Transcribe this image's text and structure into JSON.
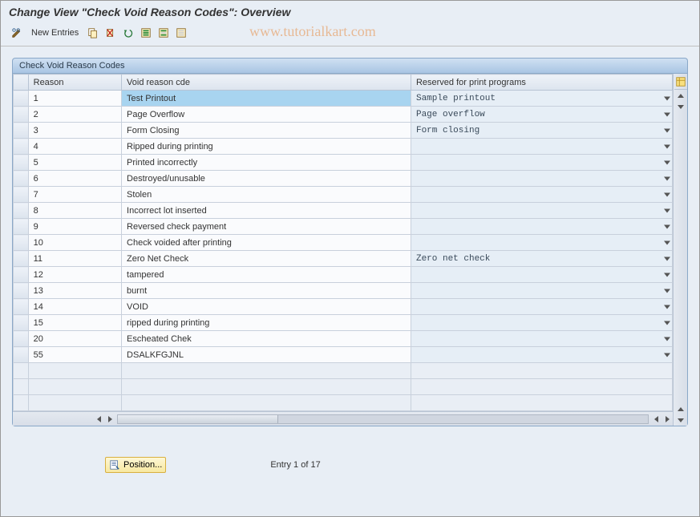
{
  "title": "Change View \"Check Void Reason Codes\": Overview",
  "toolbar": {
    "new_entries_label": "New Entries"
  },
  "watermark": "www.tutorialkart.com",
  "panel": {
    "header": "Check Void Reason Codes",
    "columns": {
      "reason": "Reason",
      "void_reason_cde": "Void reason cde",
      "reserved": "Reserved for print programs"
    },
    "rows": [
      {
        "reason": "1",
        "desc": "Test Printout",
        "reserved": "Sample printout"
      },
      {
        "reason": "2",
        "desc": "Page Overflow",
        "reserved": "Page overflow"
      },
      {
        "reason": "3",
        "desc": "Form Closing",
        "reserved": "Form closing"
      },
      {
        "reason": "4",
        "desc": "Ripped during printing",
        "reserved": ""
      },
      {
        "reason": "5",
        "desc": "Printed incorrectly",
        "reserved": ""
      },
      {
        "reason": "6",
        "desc": "Destroyed/unusable",
        "reserved": ""
      },
      {
        "reason": "7",
        "desc": "Stolen",
        "reserved": ""
      },
      {
        "reason": "8",
        "desc": "Incorrect lot inserted",
        "reserved": ""
      },
      {
        "reason": "9",
        "desc": "Reversed check payment",
        "reserved": ""
      },
      {
        "reason": "10",
        "desc": "Check voided after printing",
        "reserved": ""
      },
      {
        "reason": "11",
        "desc": "Zero Net Check",
        "reserved": "Zero net check"
      },
      {
        "reason": "12",
        "desc": "tampered",
        "reserved": ""
      },
      {
        "reason": "13",
        "desc": "burnt",
        "reserved": ""
      },
      {
        "reason": "14",
        "desc": "VOID",
        "reserved": ""
      },
      {
        "reason": "15",
        "desc": "ripped during printing",
        "reserved": ""
      },
      {
        "reason": "20",
        "desc": "Escheated Chek",
        "reserved": ""
      },
      {
        "reason": "55",
        "desc": "DSALKFGJNL",
        "reserved": ""
      }
    ],
    "empty_rows": 3
  },
  "footer": {
    "position_label": "Position...",
    "entry_status": "Entry 1 of 17"
  }
}
